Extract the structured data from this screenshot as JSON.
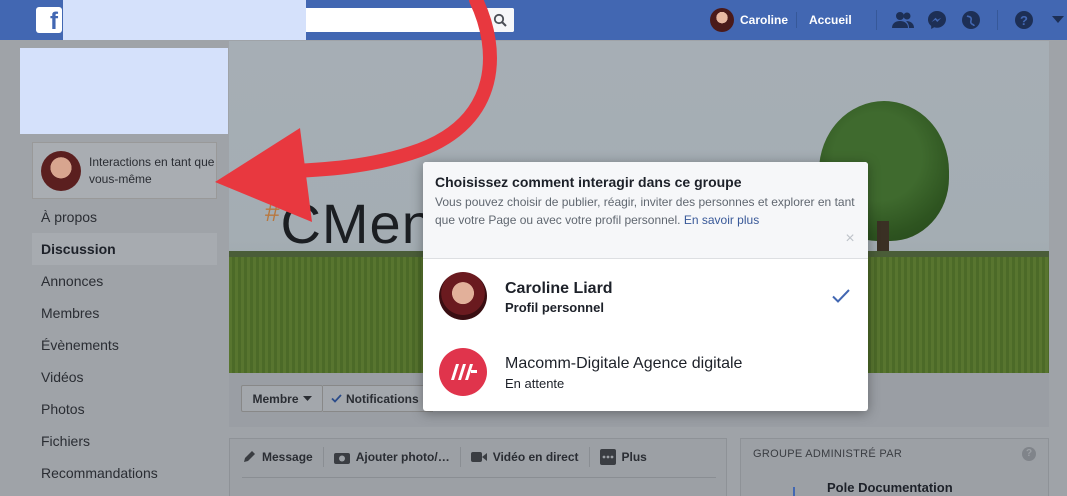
{
  "topbar": {
    "logo_letter": "f",
    "user_name": "Caroline",
    "home_label": "Accueil"
  },
  "sidebar": {
    "interact_label": "Interactions en tant que vous-même",
    "items": [
      {
        "label": "À propos",
        "active": false
      },
      {
        "label": "Discussion",
        "active": true
      },
      {
        "label": "Annonces",
        "active": false
      },
      {
        "label": "Membres",
        "active": false
      },
      {
        "label": "Évènements",
        "active": false
      },
      {
        "label": "Vidéos",
        "active": false
      },
      {
        "label": "Photos",
        "active": false
      },
      {
        "label": "Fichiers",
        "active": false
      },
      {
        "label": "Recommandations",
        "active": false
      }
    ]
  },
  "cover": {
    "hash": "#",
    "text": "CMen"
  },
  "actions": {
    "member_label": "Membre",
    "notifications_label": "Notifications"
  },
  "composer": {
    "tabs": [
      "Message",
      "Ajouter photo/…",
      "Vidéo en direct",
      "Plus"
    ]
  },
  "admin_box": {
    "title": "GROUPE ADMINISTRÉ PAR",
    "help": "?",
    "name": "Pole Documentation"
  },
  "modal": {
    "title": "Choisissez comment interagir dans ce groupe",
    "description": "Vous pouvez choisir de publier, réagir, inviter des personnes et explorer en tant que votre Page ou avec votre profil personnel.",
    "link": "En savoir plus",
    "close": "×",
    "options": [
      {
        "name": "Caroline Liard",
        "sub": "Profil personnel",
        "selected": true
      },
      {
        "name": "Macomm-Digitale Agence digitale",
        "sub": "En attente",
        "selected": false
      }
    ]
  },
  "colors": {
    "topbar": "#4267b2",
    "accent": "#4267b2",
    "arrow": "#e8383f",
    "page_avatar": "#e0344c"
  }
}
